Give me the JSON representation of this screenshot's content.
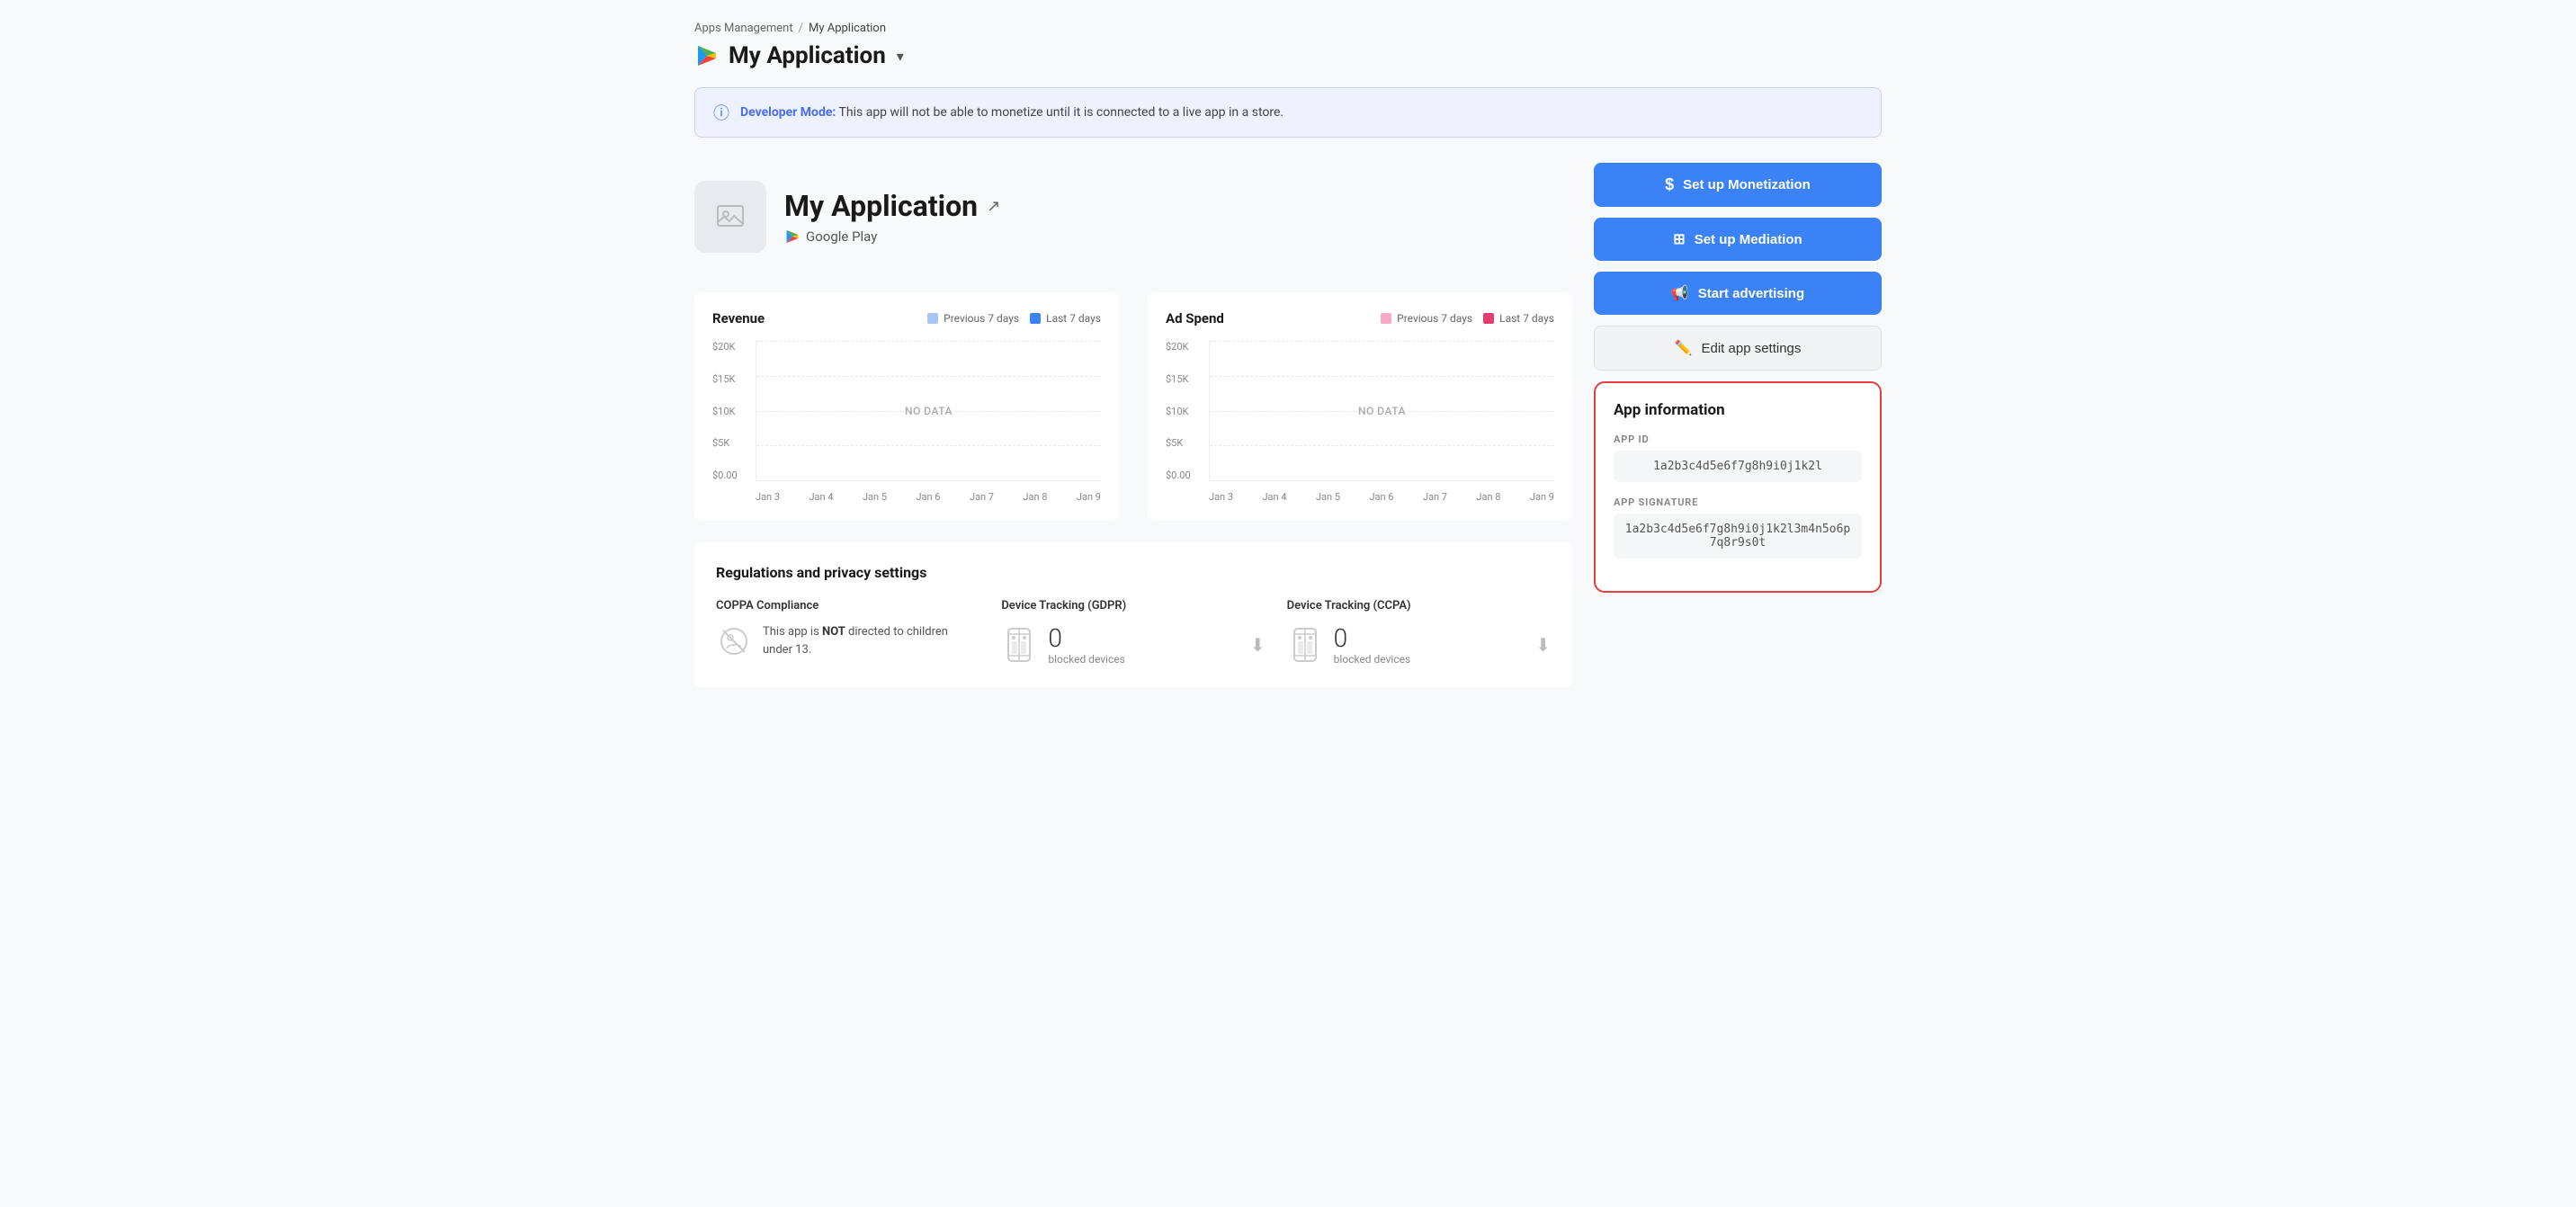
{
  "breadcrumb": {
    "parent": "Apps Management",
    "separator": "/",
    "current": "My Application"
  },
  "header": {
    "app_name": "My Application",
    "dropdown_arrow": "▾"
  },
  "banner": {
    "label": "Developer Mode:",
    "message": "This app will not be able to monetize until it is connected to a live app in a store."
  },
  "app_identity": {
    "name": "My Application",
    "store": "Google Play"
  },
  "revenue_chart": {
    "title": "Revenue",
    "legend_prev": "Previous 7 days",
    "legend_last": "Last 7 days",
    "prev_color": "#a8c4f5",
    "last_color": "#3b82f6",
    "y_labels": [
      "$20K",
      "$15K",
      "$10K",
      "$5K",
      "$0.00"
    ],
    "x_labels": [
      "Jan 3",
      "Jan 4",
      "Jan 5",
      "Jan 6",
      "Jan 7",
      "Jan 8",
      "Jan 9"
    ],
    "no_data": "NO DATA"
  },
  "adspend_chart": {
    "title": "Ad Spend",
    "legend_prev": "Previous 7 days",
    "legend_last": "Last 7 days",
    "prev_color": "#f9a8c9",
    "last_color": "#e53e6e",
    "y_labels": [
      "$20K",
      "$15K",
      "$10K",
      "$5K",
      "$0.00"
    ],
    "x_labels": [
      "Jan 3",
      "Jan 4",
      "Jan 5",
      "Jan 6",
      "Jan 7",
      "Jan 8",
      "Jan 9"
    ],
    "no_data": "NO DATA"
  },
  "regulations": {
    "section_title": "Regulations and privacy settings",
    "coppa": {
      "title": "COPPA Compliance",
      "text_before": "This app is ",
      "strong": "NOT",
      "text_after": " directed to children under 13."
    },
    "gdpr": {
      "title": "Device Tracking (GDPR)",
      "count": "0",
      "label": "blocked devices"
    },
    "ccpa": {
      "title": "Device Tracking (CCPA)",
      "count": "0",
      "label": "blocked devices"
    }
  },
  "actions": {
    "monetization": "Set up Monetization",
    "mediation": "Set up Mediation",
    "advertising": "Start advertising",
    "edit_settings": "Edit app settings"
  },
  "app_info": {
    "title": "App information",
    "app_id_label": "APP ID",
    "app_id_value": "1a2b3c4d5e6f7g8h9i0j1k2l",
    "signature_label": "APP SIGNATURE",
    "signature_value": "1a2b3c4d5e6f7g8h9i0j1k2l3m4n5o6p7q8r9s0t"
  }
}
